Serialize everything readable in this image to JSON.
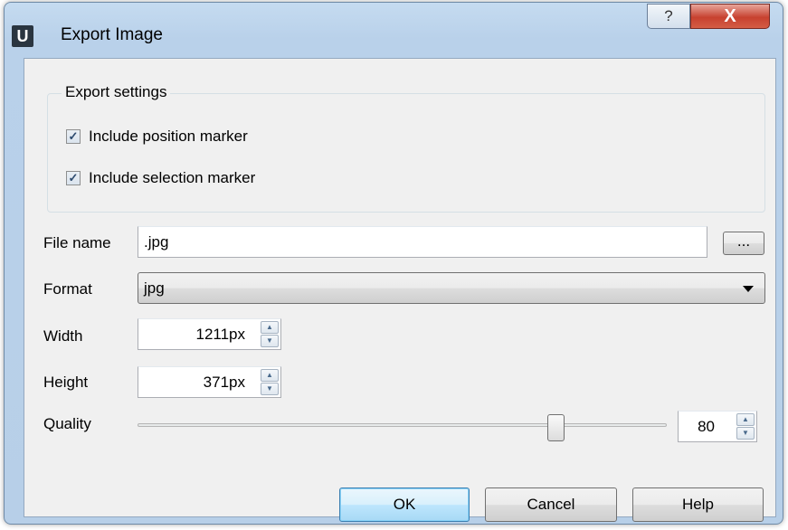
{
  "window": {
    "app_icon": "U",
    "title": "Export Image",
    "help_glyph": "?",
    "close_glyph": "X"
  },
  "export_settings": {
    "legend": "Export settings",
    "include_position_marker": {
      "label": "Include position marker",
      "checked": true
    },
    "include_selection_marker": {
      "label": "Include selection marker",
      "checked": true
    },
    "check_glyph": "✓"
  },
  "file_name": {
    "label": "File name",
    "value": ".jpg",
    "browse_label": "..."
  },
  "format": {
    "label": "Format",
    "selected": "jpg"
  },
  "width": {
    "label": "Width",
    "value": "1211px"
  },
  "height": {
    "label": "Height",
    "value": "371px"
  },
  "quality": {
    "label": "Quality",
    "value": "80",
    "level_percent": 80
  },
  "spin_icons": {
    "up": "▲",
    "down": "▼"
  },
  "buttons": {
    "ok": "OK",
    "cancel": "Cancel",
    "help": "Help"
  }
}
